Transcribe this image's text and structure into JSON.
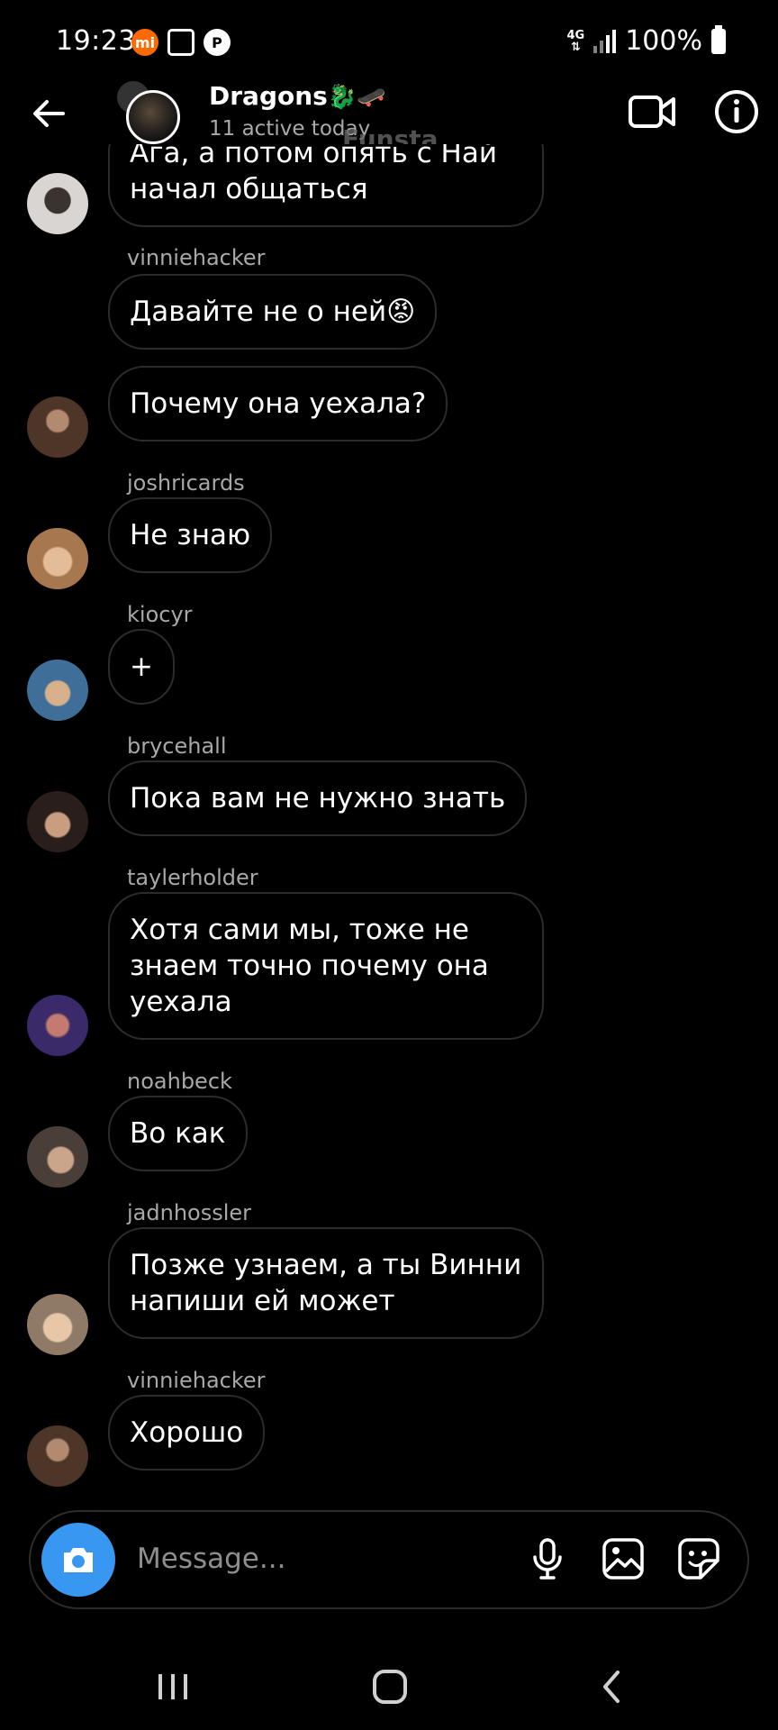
{
  "status_bar": {
    "time": "19:23",
    "network": "4G",
    "battery": "100%"
  },
  "header": {
    "title": "Dragons",
    "title_emoji": "🐉🛹",
    "subtitle": "11 active today",
    "watermark": "Funsta"
  },
  "messages": [
    {
      "sender": "",
      "text": "Ага, а потом опять с Най начал общаться",
      "avatar_color": "#c9c4c0"
    },
    {
      "sender": "vinniehacker",
      "text": "Давайте  не о ней😡",
      "avatar_color": ""
    },
    {
      "sender": "",
      "text": "Почему она уехала?",
      "avatar_color": "#6b4a38"
    },
    {
      "sender": "joshricards",
      "text": "Не знаю",
      "avatar_color": "#c8a07a"
    },
    {
      "sender": "kiocyr",
      "text": "+",
      "avatar_color": "#4a6a88"
    },
    {
      "sender": "brycehall",
      "text": "Пока вам не нужно знать",
      "avatar_color": "#3a2a24"
    },
    {
      "sender": "taylerholder",
      "text": "Хотя сами мы, тоже не знаем точно почему она уехала",
      "avatar_color": "#5a3a7a"
    },
    {
      "sender": "noahbeck",
      "text": "Во как",
      "avatar_color": "#7a6a60"
    },
    {
      "sender": "jadnhossler",
      "text": "Позже узнаем, а ты Винни напиши ей может",
      "avatar_color": "#b9a894"
    },
    {
      "sender": "vinniehacker",
      "text": "Хорошо",
      "avatar_color": "#5a4438"
    }
  ],
  "composer": {
    "placeholder": "Message..."
  }
}
